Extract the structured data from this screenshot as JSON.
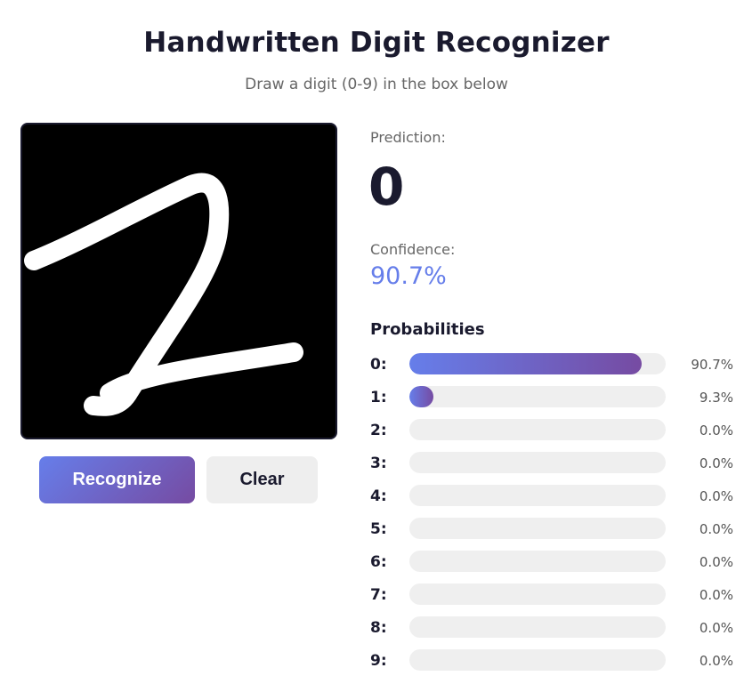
{
  "header": {
    "title": "Handwritten Digit Recognizer",
    "subtitle": "Draw a digit (0-9) in the box below"
  },
  "buttons": {
    "recognize_label": "Recognize",
    "clear_label": "Clear"
  },
  "result": {
    "prediction_label": "Prediction:",
    "prediction_value": "0",
    "confidence_label": "Confidence:",
    "confidence_value": "90.7%"
  },
  "probabilities": {
    "heading": "Probabilities",
    "rows": [
      {
        "digit": "0:",
        "value": 0.907,
        "percent": "90.7%"
      },
      {
        "digit": "1:",
        "value": 0.093,
        "percent": "9.3%"
      },
      {
        "digit": "2:",
        "value": 0.0,
        "percent": "0.0%"
      },
      {
        "digit": "3:",
        "value": 0.0,
        "percent": "0.0%"
      },
      {
        "digit": "4:",
        "value": 0.0,
        "percent": "0.0%"
      },
      {
        "digit": "5:",
        "value": 0.0,
        "percent": "0.0%"
      },
      {
        "digit": "6:",
        "value": 0.0,
        "percent": "0.0%"
      },
      {
        "digit": "7:",
        "value": 0.0,
        "percent": "0.0%"
      },
      {
        "digit": "8:",
        "value": 0.0,
        "percent": "0.0%"
      },
      {
        "digit": "9:",
        "value": 0.0,
        "percent": "0.0%"
      }
    ]
  },
  "colors": {
    "accent_start": "#667eea",
    "accent_end": "#764ba2",
    "canvas_background": "#000000",
    "stroke": "#ffffff"
  }
}
